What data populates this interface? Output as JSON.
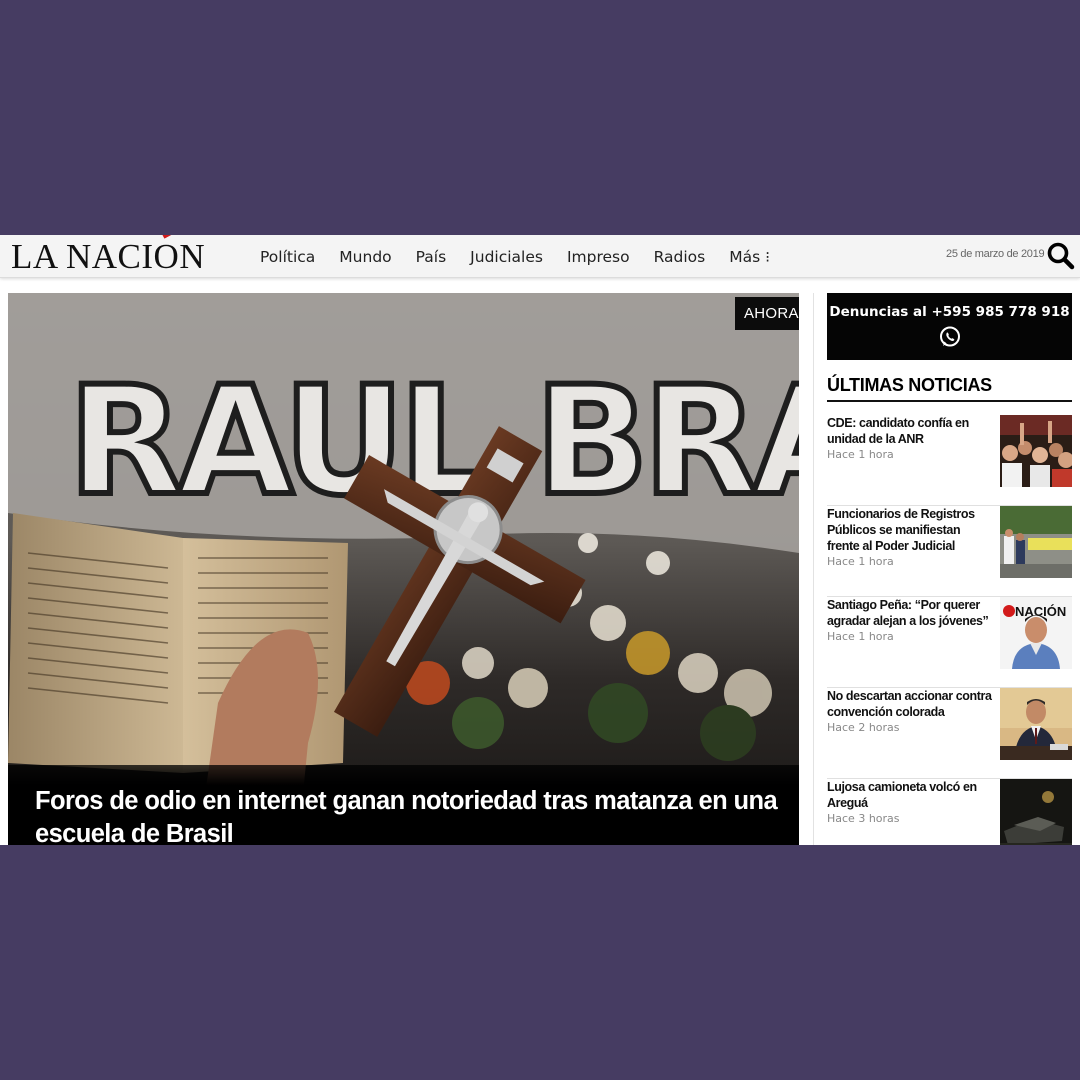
{
  "header": {
    "logo": "LA NACIÓN",
    "nav": [
      "Política",
      "Mundo",
      "País",
      "Judiciales",
      "Impreso",
      "Radios",
      "Más ⁝"
    ],
    "date": "25 de marzo de 2019",
    "search_icon": "search-icon"
  },
  "hero": {
    "badge": "AHORA",
    "title": "Foros de odio en internet ganan notoriedad tras matanza en una escuela de Brasil",
    "photo_wall_text": "RAUL BRASIL"
  },
  "sidebar": {
    "denuncias_text": "Denuncias al +595 985 778 918",
    "denuncias_icon": "whatsapp-icon",
    "section_title": "ÚLTIMAS NOTICIAS",
    "items": [
      {
        "headline": "CDE: candidato confía en unidad de la ANR",
        "time": "Hace 1 hora"
      },
      {
        "headline": "Funcionarios de Registros Públicos se manifiestan frente al Poder Judicial",
        "time": "Hace 1 hora"
      },
      {
        "headline": "Santiago Peña: “Por querer agradar alejan a los jóvenes”",
        "time": "Hace 1 hora"
      },
      {
        "headline": "No descartan accionar contra convención colorada",
        "time": "Hace 2 horas"
      },
      {
        "headline": "Lujosa camioneta volcó en Areguá",
        "time": "Hace 3 horas"
      }
    ],
    "thumb_3_text": "NACIÓN"
  },
  "colors": {
    "background": "#463c62",
    "logo_accent": "#d21a1a",
    "badge": "#0c0c0c"
  }
}
